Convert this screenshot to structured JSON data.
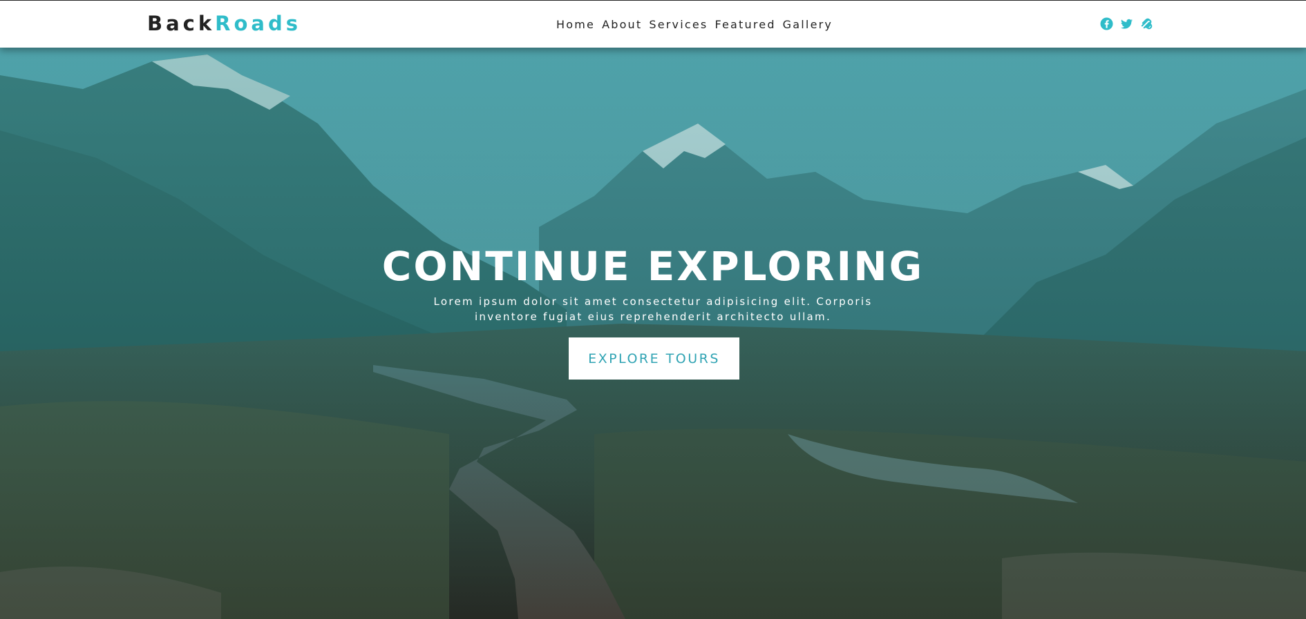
{
  "navbar": {
    "logo_part1": "Back",
    "logo_part2": "Roads",
    "links": [
      "Home",
      "About",
      "Services",
      "Featured",
      "Gallery"
    ],
    "social_icons": [
      "facebook-icon",
      "twitter-icon",
      "squarespace-icon"
    ]
  },
  "hero": {
    "title": "CONTINUE EXPLORING",
    "subtitle": "Lorem ipsum dolor sit amet consectetur adipisicing elit. Corporis inventore fugiat eius reprehenderit architecto ullam.",
    "button_label": "EXPLORE TOURS"
  },
  "colors": {
    "accent": "#2fbcc9",
    "dark": "#222222",
    "button_text": "#2fa3b3"
  }
}
